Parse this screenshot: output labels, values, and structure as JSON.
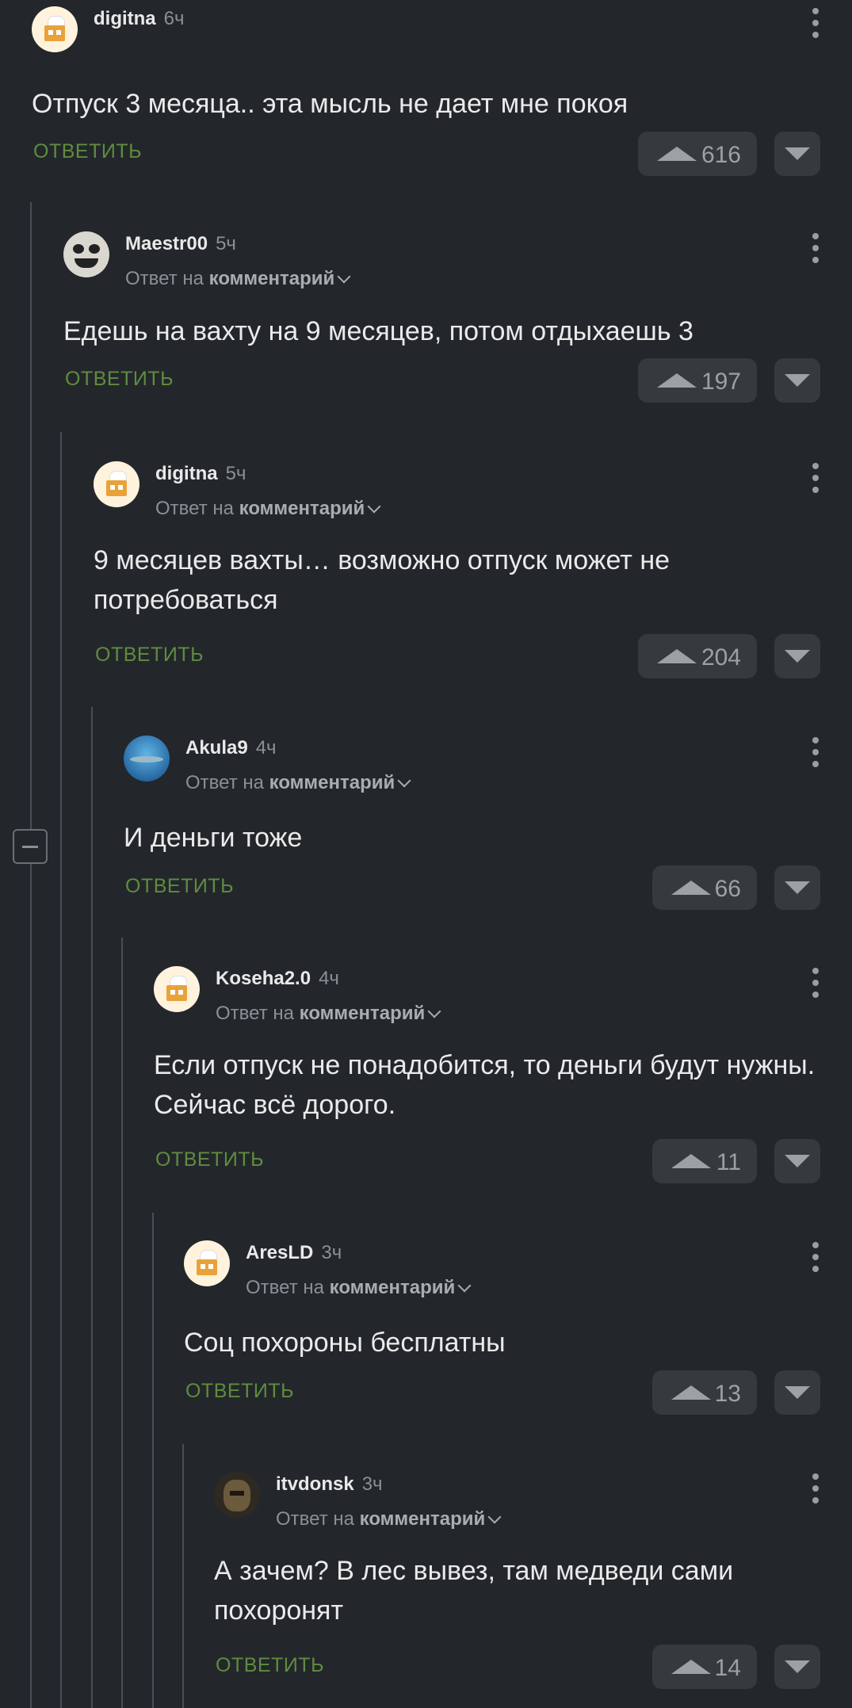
{
  "comments": [
    {
      "user": "digitna",
      "time": "6ч",
      "reply_prefix": "",
      "reply_link": "",
      "text": "Отпуск 3 месяца.. эта мысль не дает мне покоя",
      "reply_label": "ОТВЕТИТЬ",
      "votes": "616",
      "avatar": "cake-avatar"
    },
    {
      "user": "Maestr00",
      "time": "5ч",
      "reply_prefix": "Ответ на",
      "reply_link": "комментарий",
      "text": "Едешь на вахту на 9 месяцев, потом отдыхаешь 3",
      "reply_label": "ОТВЕТИТЬ",
      "votes": "197",
      "avatar": "panda-avatar"
    },
    {
      "user": "digitna",
      "time": "5ч",
      "reply_prefix": "Ответ на",
      "reply_link": "комментарий",
      "text": "9 месяцев вахты… возможно отпуск может не потребоваться",
      "reply_label": "ОТВЕТИТЬ",
      "votes": "204",
      "avatar": "cake-avatar"
    },
    {
      "user": "Akula9",
      "time": "4ч",
      "reply_prefix": "Ответ на",
      "reply_link": "комментарий",
      "text": "И деньги тоже",
      "reply_label": "ОТВЕТИТЬ",
      "votes": "66",
      "avatar": "shark-avatar"
    },
    {
      "user": "Koseha2.0",
      "time": "4ч",
      "reply_prefix": "Ответ на",
      "reply_link": "комментарий",
      "text": "Если отпуск не понадобится, то деньги будут нужны. Сейчас всё дорого.",
      "reply_label": "ОТВЕТИТЬ",
      "votes": "11",
      "avatar": "cake-avatar"
    },
    {
      "user": "AresLD",
      "time": "3ч",
      "reply_prefix": "Ответ на",
      "reply_link": "комментарий",
      "text": "Соц похороны бесплатны",
      "reply_label": "ОТВЕТИТЬ",
      "votes": "13",
      "avatar": "cake-avatar"
    },
    {
      "user": "itvdonsk",
      "time": "3ч",
      "reply_prefix": "Ответ на",
      "reply_link": "комментарий",
      "text": "А зачем? В лес вывез, там медведи сами похоронят",
      "reply_label": "ОТВЕТИТЬ",
      "votes": "14",
      "avatar": "hedgehog-avatar"
    }
  ],
  "colors": {
    "background": "#23272b",
    "accent_reply": "#5f8c3f",
    "vote_bg": "#363a3f"
  }
}
